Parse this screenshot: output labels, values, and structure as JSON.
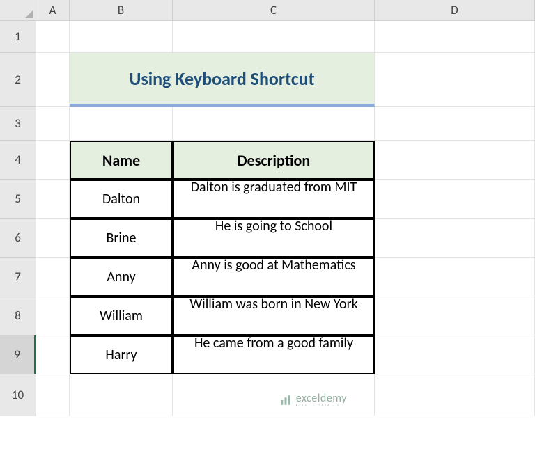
{
  "columns": [
    "A",
    "B",
    "C",
    "D"
  ],
  "rows": [
    "1",
    "2",
    "3",
    "4",
    "5",
    "6",
    "7",
    "8",
    "9",
    "10"
  ],
  "active_row": "9",
  "title": "Using Keyboard Shortcut",
  "table": {
    "headers": {
      "name": "Name",
      "description": "Description"
    },
    "data": [
      {
        "name": "Dalton",
        "description": "Dalton is graduated from MIT"
      },
      {
        "name": "Brine",
        "description": "He is going to School"
      },
      {
        "name": "Anny",
        "description": "Anny is good at Mathematics"
      },
      {
        "name": "William",
        "description": "William was born in New York"
      },
      {
        "name": "Harry",
        "description": "He came from a good family"
      }
    ]
  },
  "watermark": {
    "text": "exceldemy",
    "subtext": "EXCEL · DATA · BI"
  },
  "chart_data": {
    "type": "table",
    "title": "Using Keyboard Shortcut",
    "columns": [
      "Name",
      "Description"
    ],
    "rows": [
      [
        "Dalton",
        "Dalton is graduated from MIT"
      ],
      [
        "Brine",
        "He is going to School"
      ],
      [
        "Anny",
        "Anny is good at Mathematics"
      ],
      [
        "William",
        "William was born in New York"
      ],
      [
        "Harry",
        "He came from a good family"
      ]
    ]
  }
}
